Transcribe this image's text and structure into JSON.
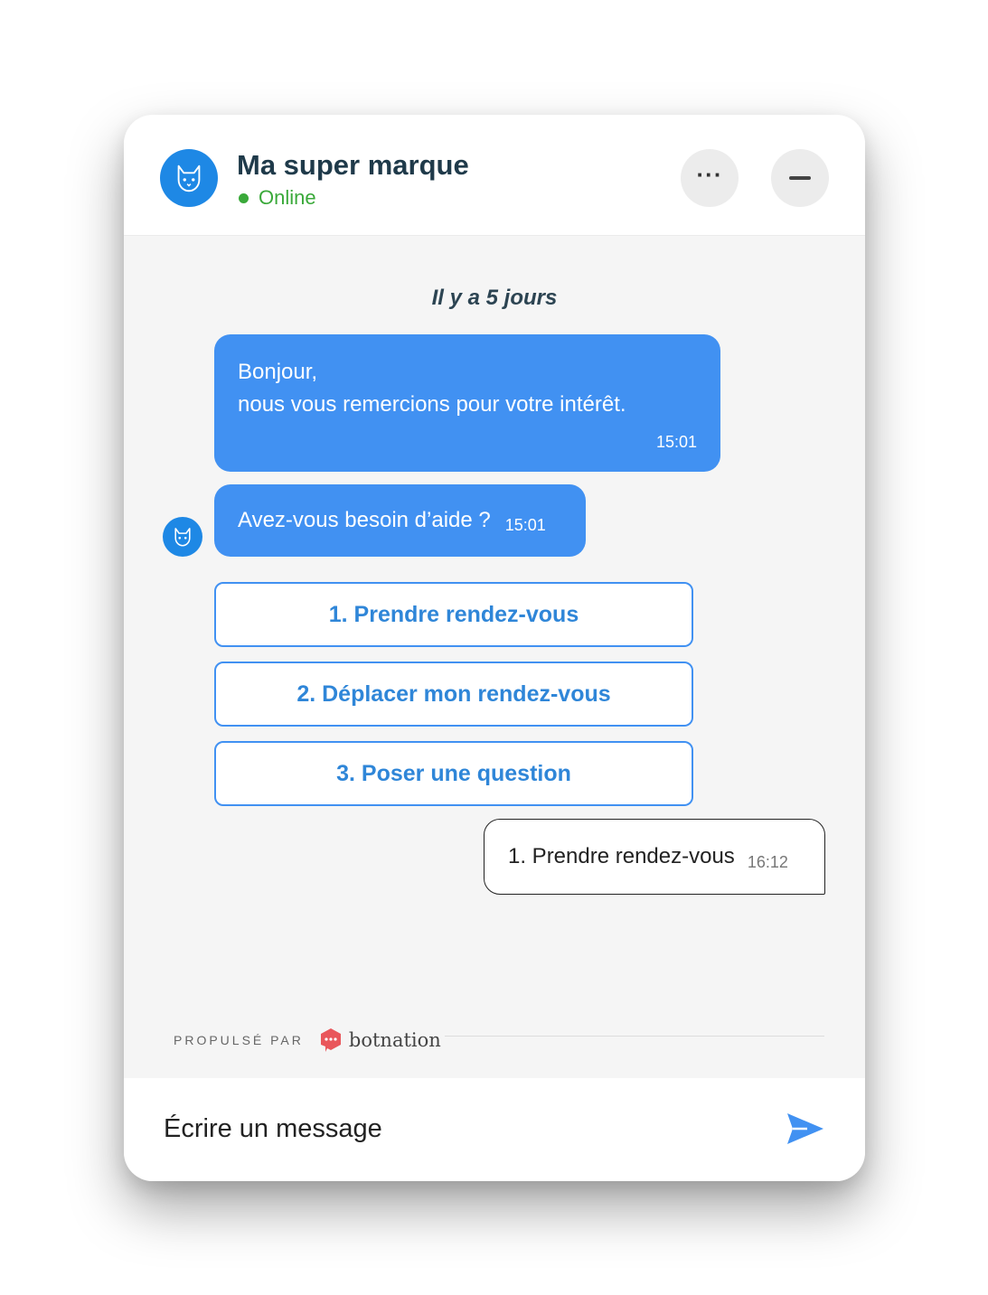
{
  "header": {
    "brand_name": "Ma super marque",
    "status": "Online",
    "more_icon": "ellipsis-icon",
    "minimize_icon": "minus-icon"
  },
  "conversation": {
    "date_separator": "Il y a 5 jours",
    "bot_message_1": {
      "lines": [
        "Bonjour,",
        "nous vous remercions pour votre intérêt."
      ],
      "time": "15:01"
    },
    "bot_message_2": {
      "text": "Avez-vous besoin d’aide ?",
      "time": "15:01"
    },
    "choices": [
      "1. Prendre rendez-vous",
      "2. Déplacer mon rendez-vous",
      "3. Poser une question"
    ],
    "user_message": {
      "text": "1. Prendre rendez-vous",
      "time": "16:12"
    }
  },
  "footer": {
    "powered_by": "PROPULSÉ PAR",
    "provider_name": "botnation"
  },
  "composer": {
    "placeholder": "Écrire un message",
    "send_icon": "send-icon"
  },
  "colors": {
    "accent": "#4191f2",
    "online": "#3aa93a",
    "title": "#1f3a4a",
    "logo": "#e9565b"
  }
}
